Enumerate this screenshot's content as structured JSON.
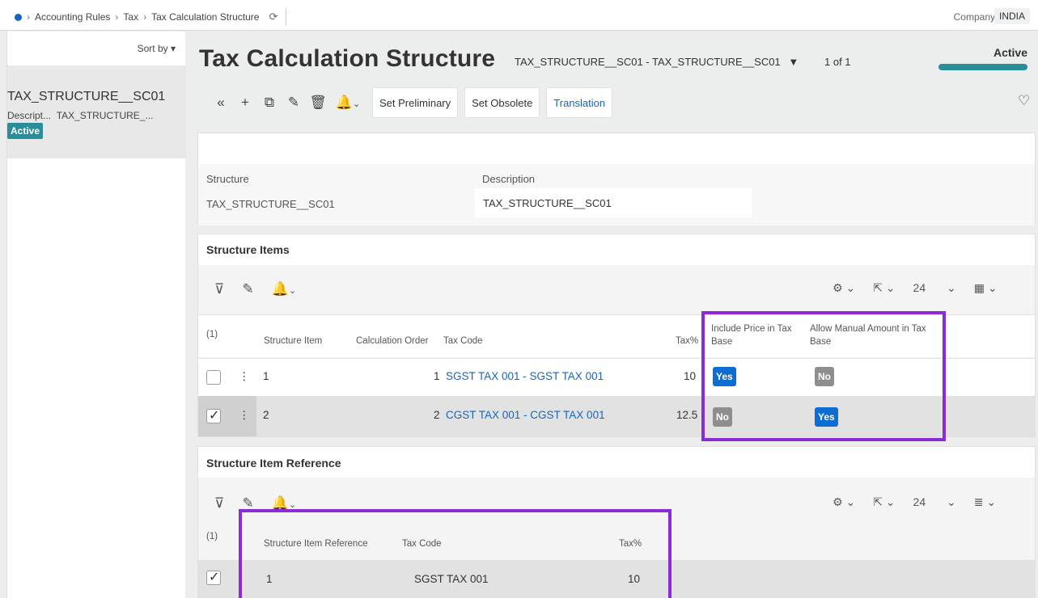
{
  "breadcrumb": [
    "Accounting Rules",
    "Tax",
    "Tax Calculation Structure"
  ],
  "company": {
    "label": "Company",
    "value": "INDIA"
  },
  "left": {
    "sort_label": "Sort by",
    "record_title": "TAX_STRUCTURE__SC01",
    "desc_label": "Descript...",
    "desc_value": "TAX_STRUCTURE_...",
    "badge": "Active"
  },
  "header": {
    "title": "Tax Calculation Structure",
    "record_selector": "TAX_STRUCTURE__SC01 - TAX_STRUCTURE__SC01",
    "record_count": "1 of 1",
    "status": "Active"
  },
  "toolbar": {
    "set_preliminary": "Set Preliminary",
    "set_obsolete": "Set Obsolete",
    "translation": "Translation"
  },
  "detail": {
    "structure_label": "Structure",
    "structure_value": "TAX_STRUCTURE__SC01",
    "description_label": "Description",
    "description_value": "TAX_STRUCTURE__SC01"
  },
  "structure_items": {
    "title": "Structure Items",
    "page_size": "24",
    "selected_count": "(1)",
    "columns": {
      "item": "Structure Item",
      "order": "Calculation Order",
      "tax_code": "Tax Code",
      "tax_pct": "Tax%",
      "include_price": "Include Price in Tax Base",
      "allow_manual": "Allow Manual Amount in Tax Base"
    },
    "rows": [
      {
        "item": "1",
        "order": "1",
        "tax_code": "SGST TAX 001 - SGST TAX 001",
        "tax_pct": "10",
        "include_price": "Yes",
        "allow_manual": "No"
      },
      {
        "item": "2",
        "order": "2",
        "tax_code": "CGST TAX 001 - CGST TAX 001",
        "tax_pct": "12.5",
        "include_price": "No",
        "allow_manual": "Yes"
      }
    ]
  },
  "item_reference": {
    "title": "Structure Item Reference",
    "page_size": "24",
    "selected_count": "(1)",
    "columns": {
      "reference": "Structure Item Reference",
      "tax_code": "Tax Code",
      "tax_pct": "Tax%"
    },
    "rows": [
      {
        "reference": "1",
        "tax_code": "SGST TAX 001",
        "tax_pct": "10"
      }
    ]
  },
  "colors": {
    "accent": "#2a8e9a",
    "link": "#1565c0",
    "highlight": "#8b2bd6",
    "yes_chip": "#0b6ed0",
    "no_chip": "#8e8e8e"
  }
}
